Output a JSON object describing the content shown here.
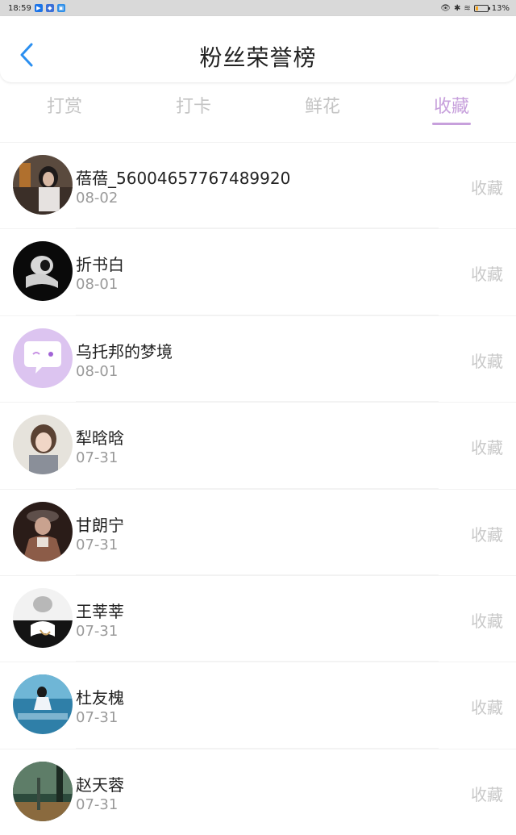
{
  "status_bar": {
    "time": "18:59",
    "battery": "13%",
    "icons": [
      "play-icon",
      "app-icon",
      "app-icon",
      "eye-icon",
      "bluetooth-icon",
      "wifi-icon",
      "battery-icon"
    ]
  },
  "header": {
    "title": "粉丝荣誉榜",
    "back_icon": "chevron-left-icon",
    "accent": "#2b8ff0"
  },
  "tabs": {
    "items": [
      {
        "label": "打赏"
      },
      {
        "label": "打卡"
      },
      {
        "label": "鲜花"
      },
      {
        "label": "收藏"
      }
    ],
    "active_index": 3,
    "active_color": "#c7a0dc"
  },
  "list": {
    "items": [
      {
        "name": "蓓蓓_56004657767489920",
        "date": "08-02",
        "action": "收藏"
      },
      {
        "name": "折书白",
        "date": "08-01",
        "action": "收藏"
      },
      {
        "name": "乌托邦的梦境",
        "date": "08-01",
        "action": "收藏"
      },
      {
        "name": "犁晗晗",
        "date": "07-31",
        "action": "收藏"
      },
      {
        "name": "甘朗宁",
        "date": "07-31",
        "action": "收藏"
      },
      {
        "name": "王莘莘",
        "date": "07-31",
        "action": "收藏"
      },
      {
        "name": "杜友槐",
        "date": "07-31",
        "action": "收藏"
      },
      {
        "name": "赵天蓉",
        "date": "07-31",
        "action": "收藏"
      }
    ]
  }
}
